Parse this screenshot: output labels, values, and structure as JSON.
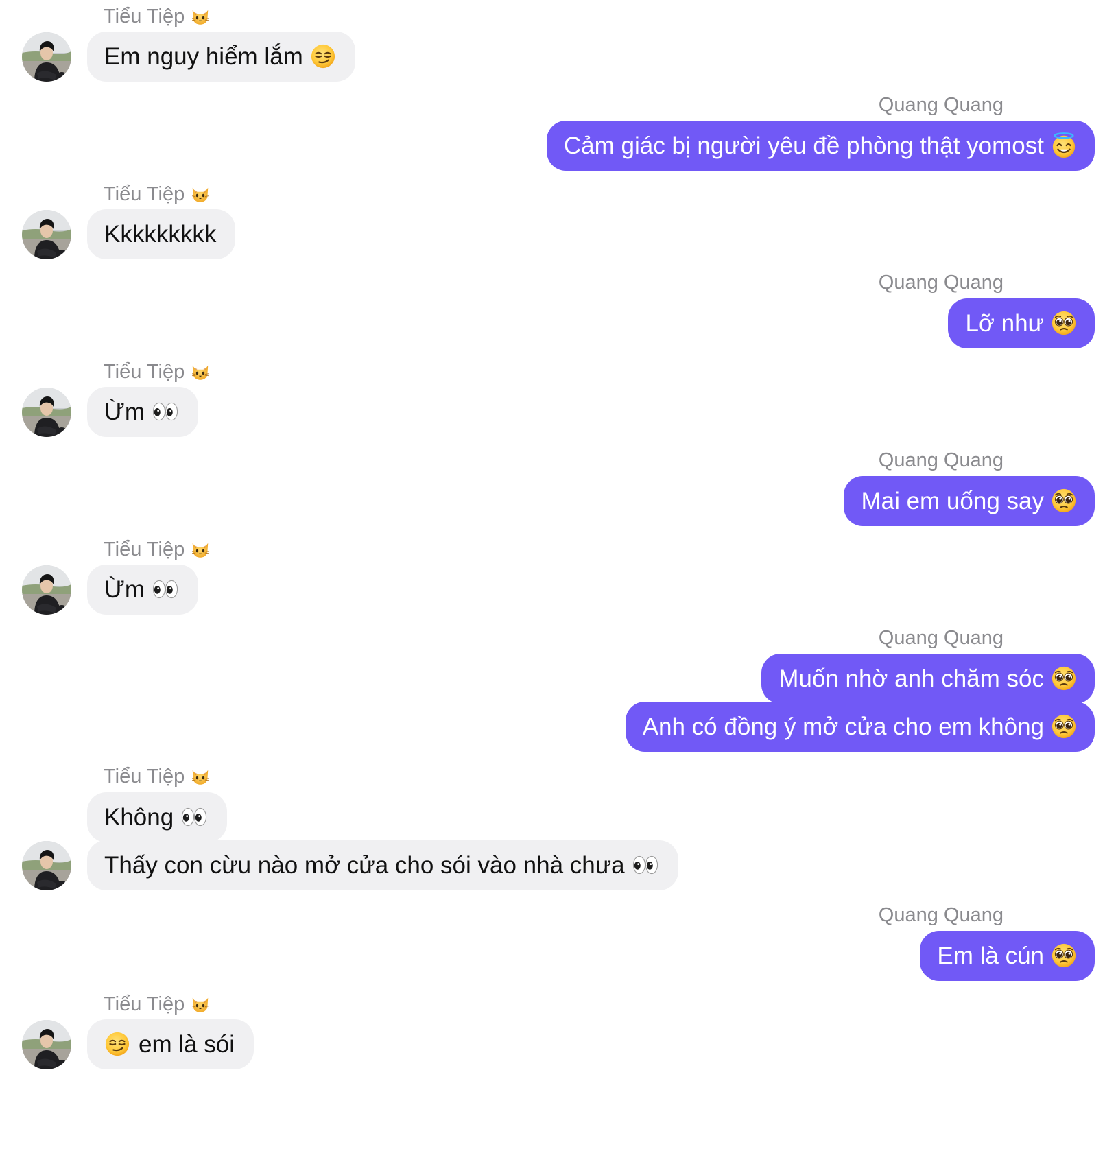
{
  "colors": {
    "outgoing_bubble": "#7159f6",
    "incoming_bubble": "#f0f0f2",
    "sender_name": "#8a8a8e"
  },
  "contacts": {
    "incoming_name": "Tiểu Tiệp",
    "incoming_name_emoji": "cat-face-icon",
    "outgoing_name": "Quang Quang"
  },
  "messages": [
    {
      "dir": "in",
      "text": "Em nguy hiểm lắm",
      "emoji": "smirk-face-icon"
    },
    {
      "dir": "out",
      "text": "Cảm giác bị người yêu đề phòng thật yomost",
      "emoji": "halo-face-icon"
    },
    {
      "dir": "in",
      "text": "Kkkkkkkkk"
    },
    {
      "dir": "out",
      "text": "Lỡ như",
      "emoji": "pleading-face-icon"
    },
    {
      "dir": "in",
      "text": "Ừm",
      "emoji": "eyes-icon"
    },
    {
      "dir": "out",
      "text": "Mai em uống say",
      "emoji": "pleading-face-icon"
    },
    {
      "dir": "in",
      "text": "Ừm",
      "emoji": "eyes-icon"
    },
    {
      "dir": "out",
      "text": "Muốn nhờ anh chăm sóc",
      "emoji": "pleading-face-icon"
    },
    {
      "dir": "out",
      "text": "Anh có đồng ý mở cửa cho em không",
      "emoji": "pleading-face-icon"
    },
    {
      "dir": "in",
      "text": "Không",
      "emoji": "eyes-icon"
    },
    {
      "dir": "in",
      "text": "Thấy con cừu nào mở cửa cho sói vào nhà chưa",
      "emoji": "eyes-icon"
    },
    {
      "dir": "out",
      "text": "Em là cún",
      "emoji": "pleading-face-icon"
    },
    {
      "dir": "in",
      "text": "em là sói",
      "emoji": "smirk-face-icon",
      "emoji_first": true
    }
  ]
}
